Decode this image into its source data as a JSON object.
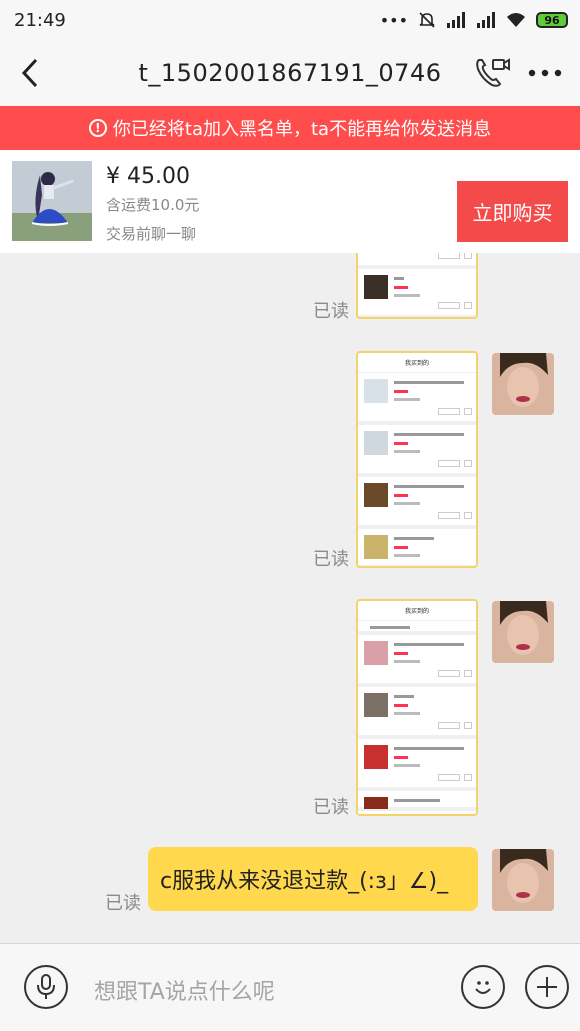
{
  "status": {
    "time": "21:49",
    "battery": "96"
  },
  "header": {
    "title": "t_1502001867191_0746"
  },
  "banner": {
    "text": "你已经将ta加入黑名单，ta不能再给你发送消息"
  },
  "product": {
    "price": "¥ 45.00",
    "shipping": "含运费10.0元",
    "chat_hint": "交易前聊一聊",
    "buy_label": "立即购买"
  },
  "messages": [
    {
      "type": "image",
      "status": "已读"
    },
    {
      "type": "image",
      "status": "已读"
    },
    {
      "type": "image",
      "status": "已读"
    },
    {
      "type": "text",
      "text": "c服我从来没退过款_(:з」∠)_",
      "status": "已读"
    }
  ],
  "input": {
    "placeholder": "想跟TA说点什么呢"
  },
  "icons": [
    "back-icon",
    "video-call-icon",
    "more-icon",
    "voice-icon",
    "emoji-icon",
    "add-icon",
    "info-icon"
  ],
  "colors": {
    "banner": "#ff4c4c",
    "buy_button": "#f34a4a",
    "bubble": "#ffd84d",
    "battery": "#5dcc3b"
  }
}
